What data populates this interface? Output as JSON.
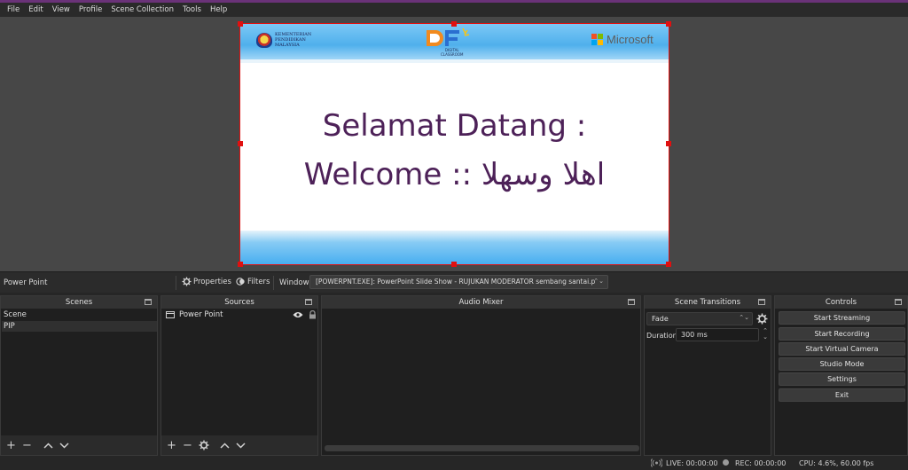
{
  "menu": [
    "File",
    "Edit",
    "View",
    "Profile",
    "Scene Collection",
    "Tools",
    "Help"
  ],
  "slide": {
    "title_line1": "Selamat Datang :",
    "title_line2": "Welcome :: اهلا وسهلا",
    "ministry_text": [
      "KEMENTERIAN",
      "PENDIDIKAN",
      "MALAYSIA"
    ],
    "df_text": [
      "DIGITAL",
      "CLASSROOM"
    ],
    "ms_text": "Microsoft"
  },
  "props_bar": {
    "source_name": "Power Point",
    "properties_label": "Properties",
    "filters_label": "Filters",
    "window_label": "Window",
    "window_value": "[POWERPNT.EXE]: PowerPoint Slide Show  -  RUJUKAN MODERATOR sembang santai.p"
  },
  "scenes": {
    "title": "Scenes",
    "items": [
      "Scene",
      "PIP"
    ],
    "selected_index": 1
  },
  "sources": {
    "title": "Sources",
    "items": [
      "Power Point"
    ]
  },
  "mixer": {
    "title": "Audio Mixer"
  },
  "transitions": {
    "title": "Scene Transitions",
    "type": "Fade",
    "duration_label": "Duration",
    "duration_value": "300 ms"
  },
  "controls": {
    "title": "Controls",
    "buttons": [
      "Start Streaming",
      "Start Recording",
      "Start Virtual Camera",
      "Studio Mode",
      "Settings",
      "Exit"
    ]
  },
  "status": {
    "live": "LIVE: 00:00:00",
    "rec": "REC: 00:00:00",
    "cpu": "CPU: 4.6%, 60.00 fps"
  },
  "colors": {
    "selection_handle": "#e01010",
    "slide_title": "#4d2158",
    "accent_line": "#6a3278"
  }
}
